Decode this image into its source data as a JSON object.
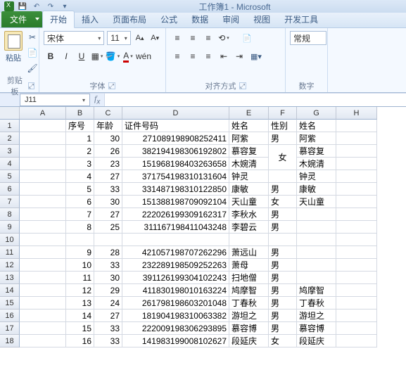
{
  "window": {
    "title": "工作簿1 - Microsoft"
  },
  "tabs": {
    "file": "文件",
    "home": "开始",
    "insert": "插入",
    "layout": "页面布局",
    "formulas": "公式",
    "data": "数据",
    "review": "审阅",
    "view": "视图",
    "dev": "开发工具"
  },
  "ribbon": {
    "clipboard": {
      "paste": "粘贴",
      "label": "剪贴板"
    },
    "font": {
      "name": "宋体",
      "size": "11",
      "label": "字体"
    },
    "align": {
      "label": "对齐方式"
    },
    "number": {
      "format": "常规",
      "label": "数字"
    }
  },
  "namebox": "J11",
  "cols": [
    "A",
    "B",
    "C",
    "D",
    "E",
    "F",
    "G",
    "H"
  ],
  "headers": {
    "B": "序号",
    "C": "年龄",
    "D": "证件号码",
    "E": "姓名",
    "F": "性别",
    "G": "姓名"
  },
  "rows": [
    {
      "n": 1,
      "B": "",
      "C": "",
      "D": "",
      "E": "",
      "F": "",
      "G": ""
    },
    {
      "n": 2,
      "B": "1",
      "C": "30",
      "D": "271089198908252411",
      "E": "阿紫",
      "F": "男",
      "G": "阿紫"
    },
    {
      "n": 3,
      "B": "2",
      "C": "26",
      "D": "382194198306192802",
      "E": "慕容复",
      "F": "女",
      "G": "慕容复",
      "Fmerge": "top"
    },
    {
      "n": 4,
      "B": "3",
      "C": "23",
      "D": "151968198403263658",
      "E": "木婉清",
      "F": "",
      "G": "木婉清",
      "Fmerge": "bottom"
    },
    {
      "n": 5,
      "B": "4",
      "C": "27",
      "D": "371754198310131604",
      "E": "钟灵",
      "F": "",
      "G": "钟灵"
    },
    {
      "n": 6,
      "B": "5",
      "C": "33",
      "D": "331487198310122850",
      "E": "康敏",
      "F": "男",
      "G": "康敏"
    },
    {
      "n": 7,
      "B": "6",
      "C": "30",
      "D": "151388198709092104",
      "E": "天山童",
      "F": "女",
      "G": "天山童"
    },
    {
      "n": 8,
      "B": "7",
      "C": "27",
      "D": "222026199309162317",
      "E": "李秋水",
      "F": "男",
      "G": ""
    },
    {
      "n": 9,
      "B": "8",
      "C": "25",
      "D": "311167198411043248",
      "E": "李碧云",
      "F": "男",
      "G": ""
    },
    {
      "n": 10,
      "B": "",
      "C": "",
      "D": "",
      "E": "",
      "F": "",
      "G": ""
    },
    {
      "n": 11,
      "B": "9",
      "C": "28",
      "D": "421057198707262296",
      "E": "萧远山",
      "F": "男",
      "G": ""
    },
    {
      "n": 12,
      "B": "10",
      "C": "33",
      "D": "232289198509252263",
      "E": "萧母",
      "F": "男",
      "G": ""
    },
    {
      "n": 13,
      "B": "11",
      "C": "30",
      "D": "391126199304102243",
      "E": "扫地僧",
      "F": "男",
      "G": ""
    },
    {
      "n": 14,
      "B": "12",
      "C": "29",
      "D": "411830198010163224",
      "E": "鸠摩智",
      "F": "男",
      "G": "鸠摩智"
    },
    {
      "n": 15,
      "B": "13",
      "C": "24",
      "D": "261798198603201048",
      "E": "丁春秋",
      "F": "男",
      "G": "丁春秋"
    },
    {
      "n": 16,
      "B": "14",
      "C": "27",
      "D": "181904198310063382",
      "E": "游坦之",
      "F": "男",
      "G": "游坦之"
    },
    {
      "n": 17,
      "B": "15",
      "C": "33",
      "D": "222009198306293895",
      "E": "慕容博",
      "F": "男",
      "G": "慕容博"
    },
    {
      "n": 18,
      "B": "16",
      "C": "33",
      "D": "141983199008102627",
      "E": "段延庆",
      "F": "女",
      "G": "段延庆"
    }
  ]
}
